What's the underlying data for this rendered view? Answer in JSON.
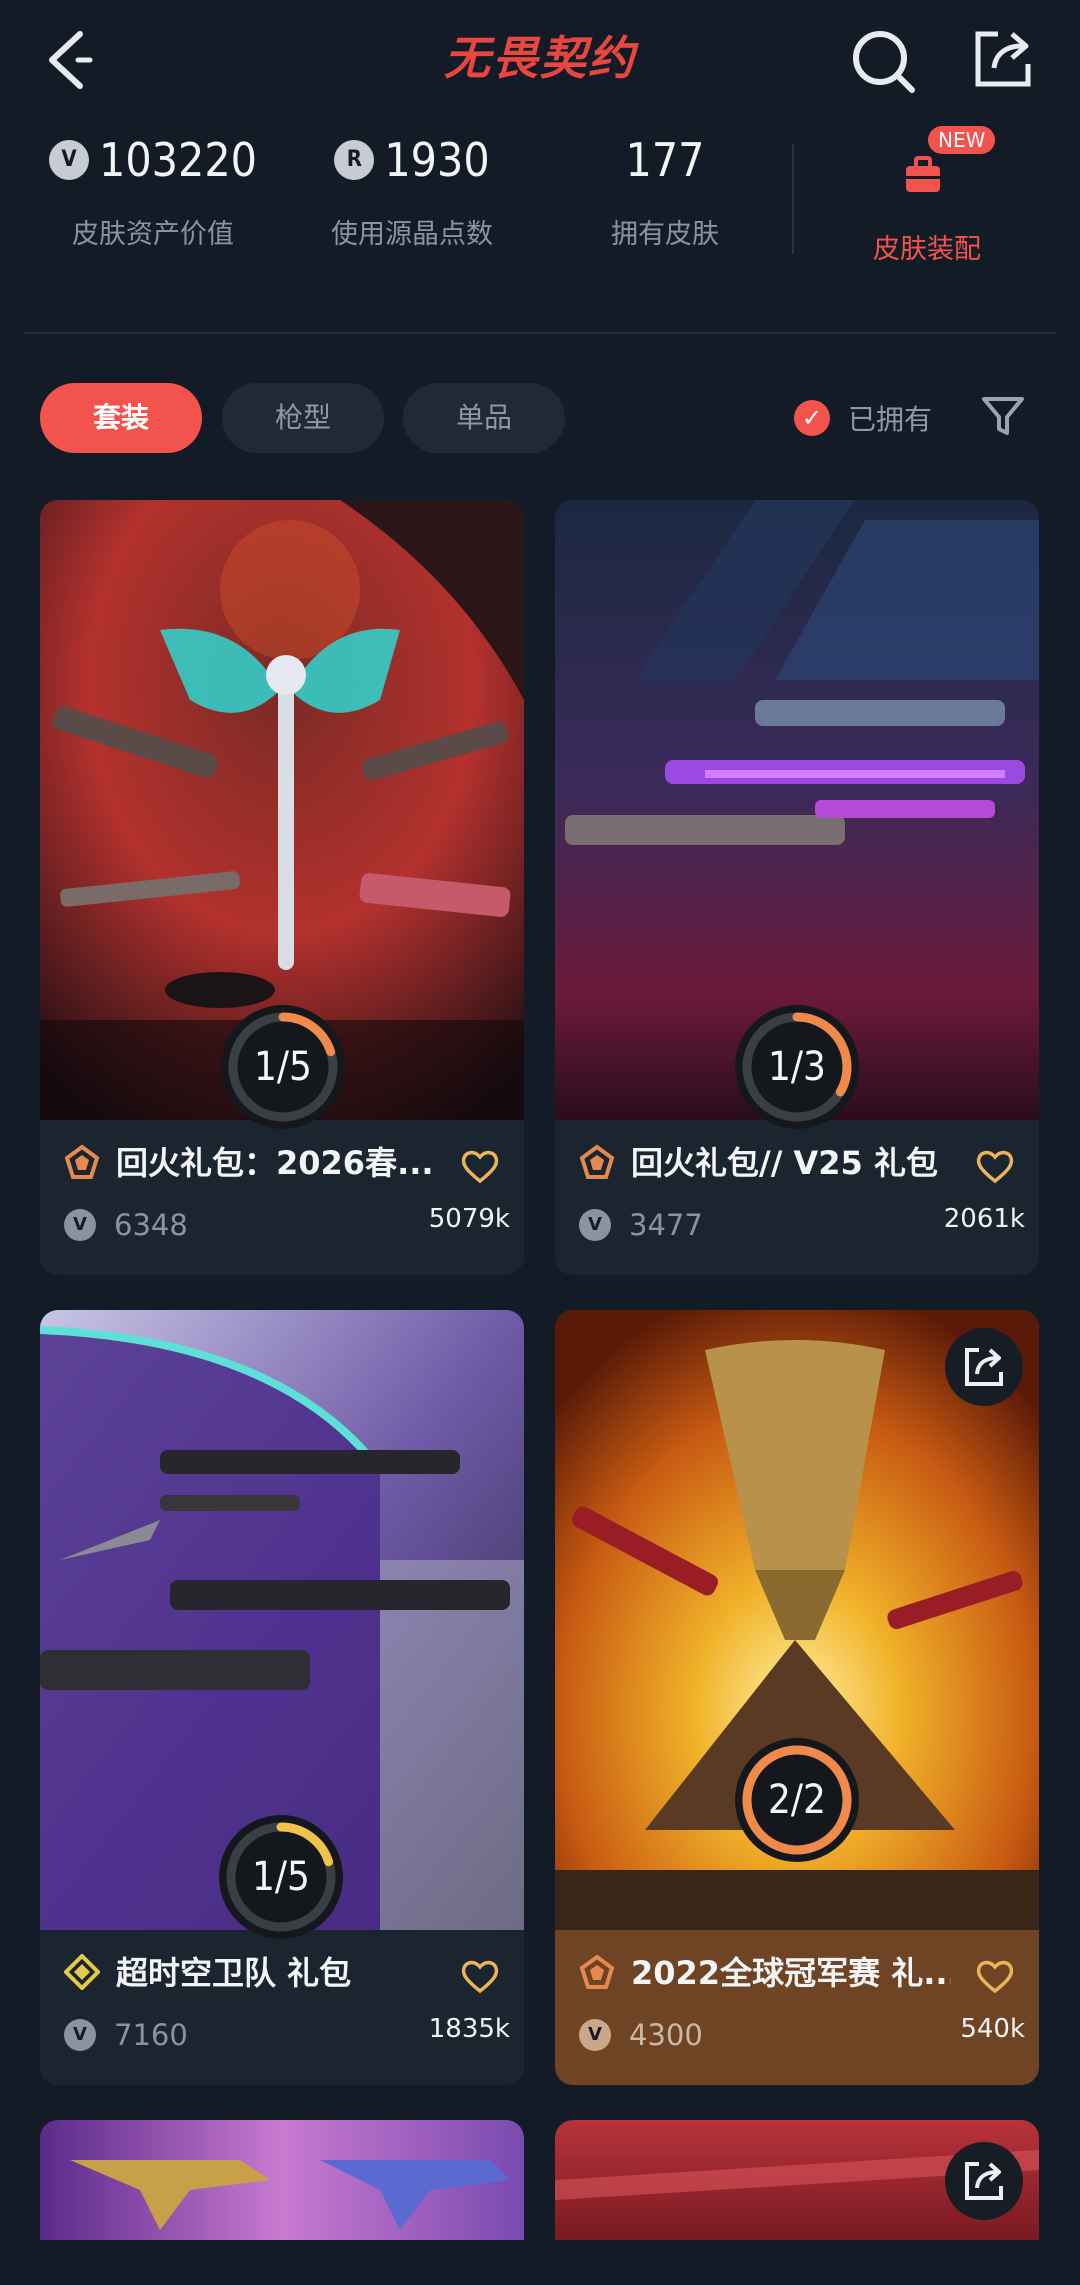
{
  "header": {
    "title": "无畏契约",
    "back_icon": "back-icon",
    "search_icon": "search-icon",
    "share_icon": "share-icon"
  },
  "stats": [
    {
      "value": "103220",
      "label": "皮肤资产价值",
      "icon": "vp-coin-icon"
    },
    {
      "value": "1930",
      "label": "使用源晶点数",
      "icon": "radianite-coin-icon"
    },
    {
      "value": "177",
      "label": "拥有皮肤"
    }
  ],
  "equip": {
    "label": "皮肤装配",
    "badge": "NEW",
    "icon": "toolbox-icon",
    "color": "#f2544d"
  },
  "tabs": [
    {
      "label": "套装",
      "active": true
    },
    {
      "label": "枪型",
      "active": false
    },
    {
      "label": "单品",
      "active": false
    }
  ],
  "owned_filter": {
    "label": "已拥有",
    "checked": true
  },
  "cards": [
    {
      "title": "回火礼包：2026春...",
      "vp": "6348",
      "likes": "5079k",
      "owned": "1/5",
      "owned_fraction": 0.2,
      "rank_icon": "premium-tier-icon"
    },
    {
      "title": "回火礼包// V25 礼包",
      "vp": "3477",
      "likes": "2061k",
      "owned": "1/3",
      "owned_fraction": 0.333,
      "rank_icon": "premium-tier-icon"
    },
    {
      "title": "超时空卫队 礼包",
      "vp": "7160",
      "likes": "1835k",
      "owned": "1/5",
      "owned_fraction": 0.2,
      "rank_icon": "select-tier-icon"
    },
    {
      "title": "2022全球冠军赛 礼...",
      "vp": "4300",
      "likes": "540k",
      "owned": "2/2",
      "owned_fraction": 1.0,
      "rank_icon": "premium-tier-icon"
    }
  ],
  "colors": {
    "accent": "#f2544d",
    "background": "#131c26",
    "progress": "#f08a4b"
  }
}
